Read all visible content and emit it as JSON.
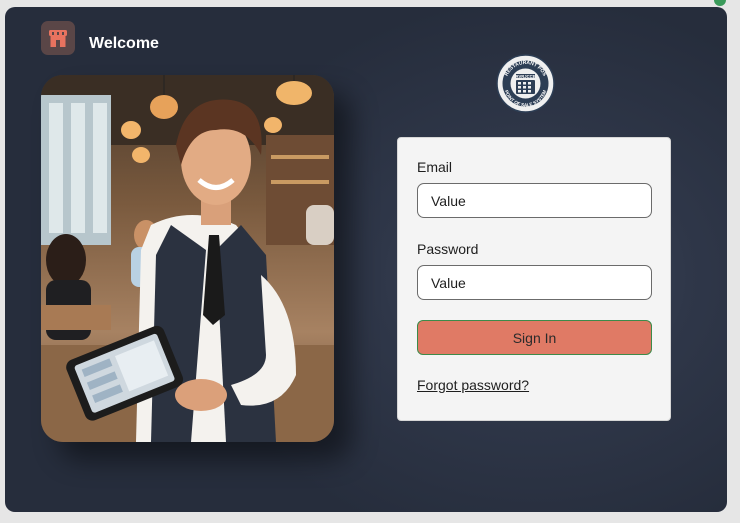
{
  "header": {
    "title": "Welcome",
    "logo_icon": "storefront-icon",
    "logo_color": "#e8735f"
  },
  "brand_seal": {
    "top_text": "RESTAURANT POS",
    "center_text": "RVRJCCE",
    "bottom_text": "POINT OF SALE SYSTEM",
    "icon": "calculator-keypad-icon"
  },
  "hero_image": {
    "icon": "waiter-with-tablet-photo"
  },
  "login": {
    "email_label": "Email",
    "email_value": "Value",
    "password_label": "Password",
    "password_value": "Value",
    "sign_in_label": "Sign In",
    "forgot_label": "Forgot password?"
  },
  "colors": {
    "background": "#2a3142",
    "accent_button": "#e07a65",
    "button_border": "#3d8a4a",
    "card": "#f4f4f4"
  }
}
